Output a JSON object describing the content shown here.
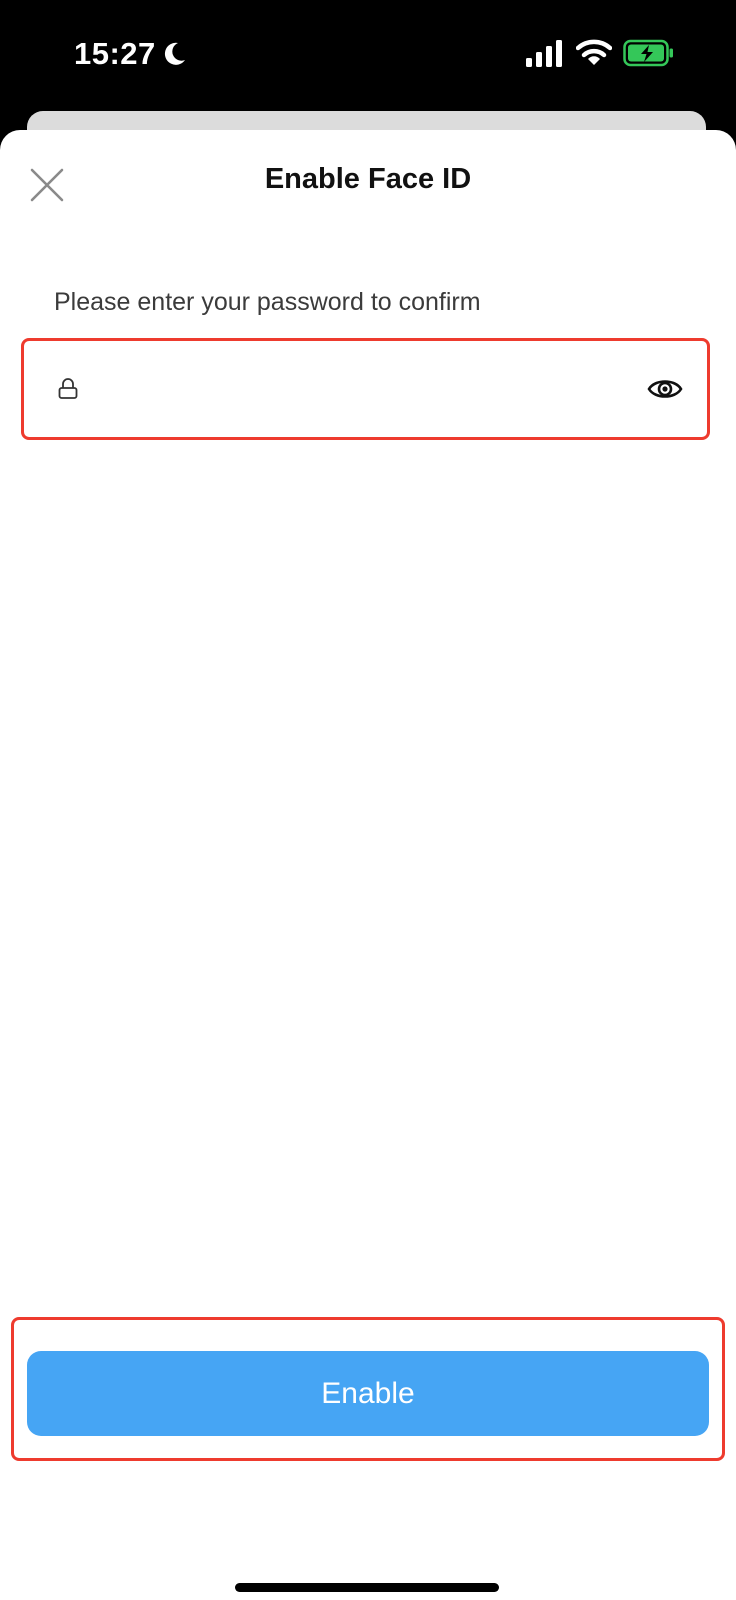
{
  "status_bar": {
    "time": "15:27",
    "icons": [
      "moon-icon",
      "signal-icon",
      "wifi-icon",
      "battery-charging-icon"
    ],
    "battery_color": "#34c759"
  },
  "sheet": {
    "title": "Enable Face ID",
    "close_icon": "close-icon"
  },
  "password": {
    "label": "Please enter your password to confirm",
    "value": "",
    "placeholder": "",
    "lock_icon": "lock-icon",
    "toggle_icon": "eye-icon"
  },
  "actions": {
    "enable_label": "Enable"
  },
  "colors": {
    "accent": "#46a5f4",
    "highlight": "#ee3b2e"
  }
}
